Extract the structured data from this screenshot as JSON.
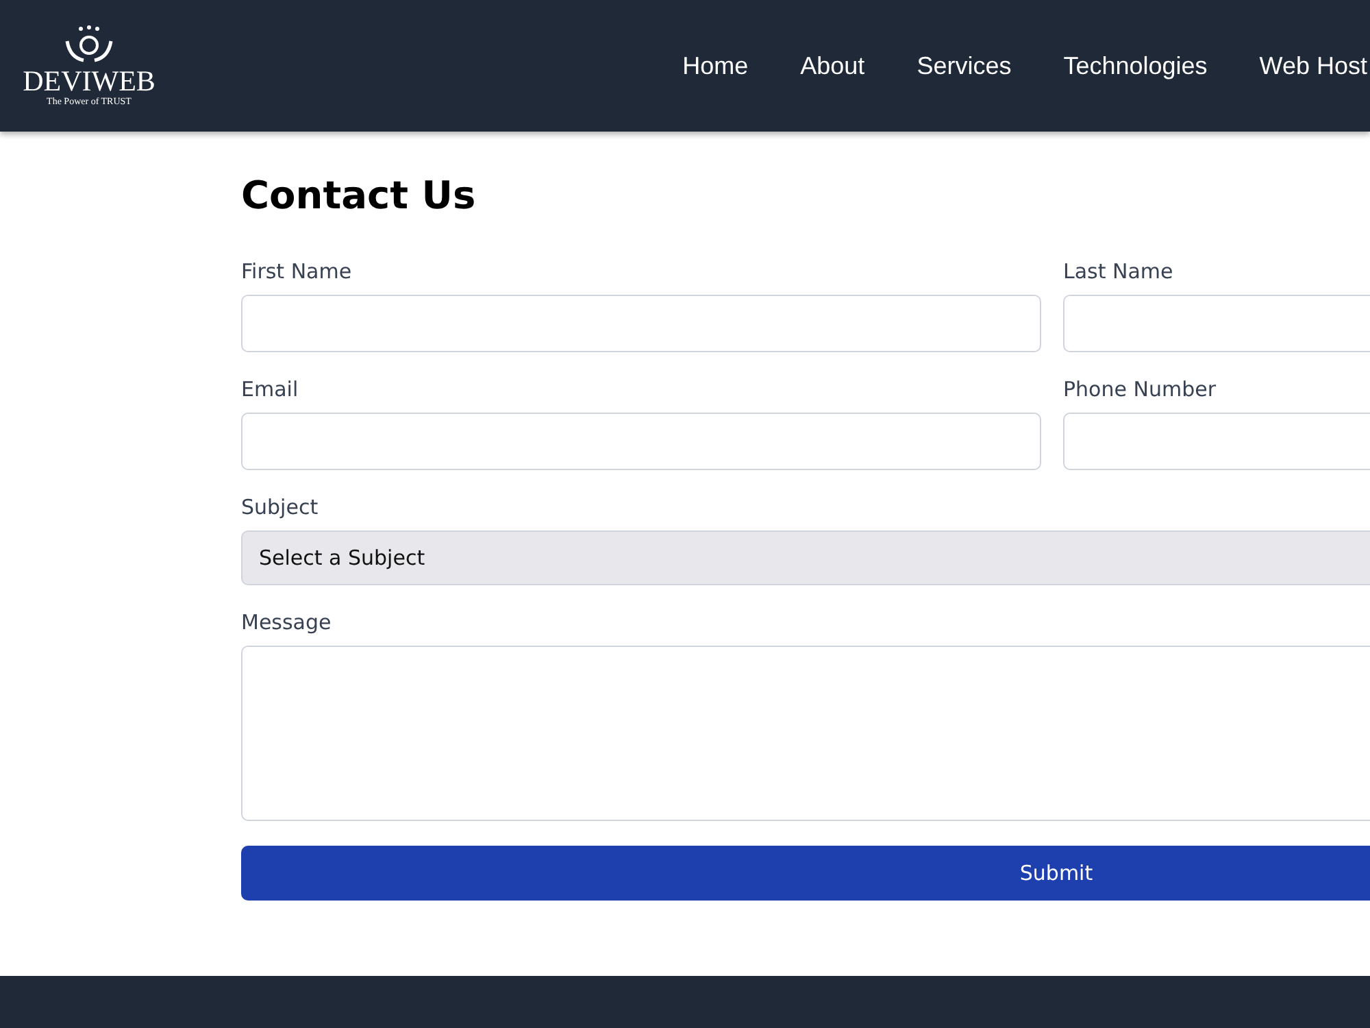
{
  "header": {
    "logo": {
      "name": "DEVIWEB",
      "tagline": "The Power of TRUST"
    },
    "nav": [
      {
        "label": "Home"
      },
      {
        "label": "About"
      },
      {
        "label": "Services"
      },
      {
        "label": "Technologies"
      },
      {
        "label": "Web Host"
      }
    ]
  },
  "form": {
    "title": "Contact Us",
    "rows": [
      [
        {
          "label": "First Name",
          "kind": "input"
        },
        {
          "label": "Last Name",
          "kind": "input"
        }
      ],
      [
        {
          "label": "Email",
          "kind": "input"
        },
        {
          "label": "Phone Number",
          "kind": "input"
        }
      ],
      [
        {
          "label": "Subject",
          "kind": "select",
          "value": "Select a Subject"
        }
      ],
      [
        {
          "label": "Message",
          "kind": "textarea"
        }
      ]
    ],
    "submit": "Submit"
  }
}
